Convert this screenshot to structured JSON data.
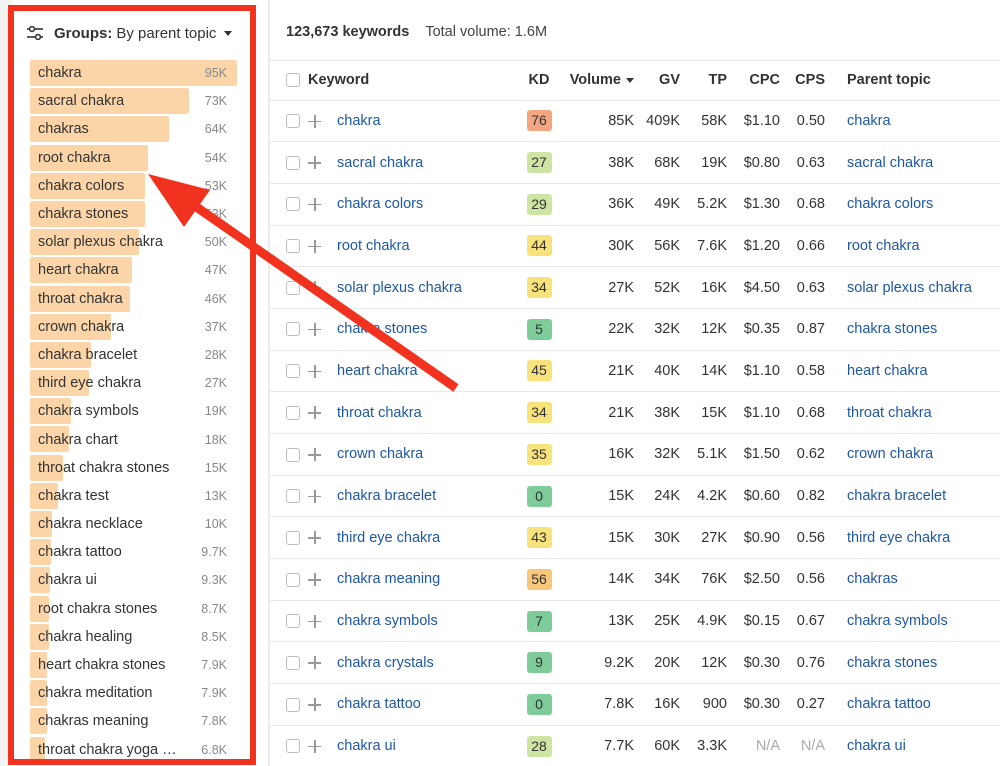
{
  "sidebar": {
    "header": {
      "label": "Groups:",
      "value": "By parent topic"
    },
    "groups": [
      {
        "label": "chakra",
        "count": "95K",
        "volume": 95
      },
      {
        "label": "sacral chakra",
        "count": "73K",
        "volume": 73
      },
      {
        "label": "chakras",
        "count": "64K",
        "volume": 64
      },
      {
        "label": "root chakra",
        "count": "54K",
        "volume": 54
      },
      {
        "label": "chakra colors",
        "count": "53K",
        "volume": 53
      },
      {
        "label": "chakra stones",
        "count": "53K",
        "volume": 53
      },
      {
        "label": "solar plexus chakra",
        "count": "50K",
        "volume": 50
      },
      {
        "label": "heart chakra",
        "count": "47K",
        "volume": 47
      },
      {
        "label": "throat chakra",
        "count": "46K",
        "volume": 46
      },
      {
        "label": "crown chakra",
        "count": "37K",
        "volume": 37
      },
      {
        "label": "chakra bracelet",
        "count": "28K",
        "volume": 28
      },
      {
        "label": "third eye chakra",
        "count": "27K",
        "volume": 27
      },
      {
        "label": "chakra symbols",
        "count": "19K",
        "volume": 19
      },
      {
        "label": "chakra chart",
        "count": "18K",
        "volume": 18
      },
      {
        "label": "throat chakra stones",
        "count": "15K",
        "volume": 15
      },
      {
        "label": "chakra test",
        "count": "13K",
        "volume": 13
      },
      {
        "label": "chakra necklace",
        "count": "10K",
        "volume": 10
      },
      {
        "label": "chakra tattoo",
        "count": "9.7K",
        "volume": 9.7
      },
      {
        "label": "chakra ui",
        "count": "9.3K",
        "volume": 9.3
      },
      {
        "label": "root chakra stones",
        "count": "8.7K",
        "volume": 8.7
      },
      {
        "label": "chakra healing",
        "count": "8.5K",
        "volume": 8.5
      },
      {
        "label": "heart chakra stones",
        "count": "7.9K",
        "volume": 7.9
      },
      {
        "label": "chakra meditation",
        "count": "7.9K",
        "volume": 7.9
      },
      {
        "label": "chakras meaning",
        "count": "7.8K",
        "volume": 7.8
      },
      {
        "label": "throat chakra yoga …",
        "count": "6.8K",
        "volume": 6.8
      }
    ]
  },
  "main": {
    "summary": {
      "keywords": "123,673 keywords",
      "total_volume": "Total volume: 1.6M"
    },
    "columns": {
      "keyword": "Keyword",
      "kd": "KD",
      "volume": "Volume",
      "gv": "GV",
      "tp": "TP",
      "cpc": "CPC",
      "cps": "CPS",
      "parent": "Parent topic"
    },
    "rows": [
      {
        "keyword": "chakra",
        "kd": "76",
        "kd_color": "#f4a582",
        "volume": "85K",
        "gv": "409K",
        "tp": "58K",
        "cpc": "$1.10",
        "cps": "0.50",
        "parent": "chakra"
      },
      {
        "keyword": "sacral chakra",
        "kd": "27",
        "kd_color": "#cde4a3",
        "volume": "38K",
        "gv": "68K",
        "tp": "19K",
        "cpc": "$0.80",
        "cps": "0.63",
        "parent": "sacral chakra"
      },
      {
        "keyword": "chakra colors",
        "kd": "29",
        "kd_color": "#cde4a3",
        "volume": "36K",
        "gv": "49K",
        "tp": "5.2K",
        "cpc": "$1.30",
        "cps": "0.68",
        "parent": "chakra colors"
      },
      {
        "keyword": "root chakra",
        "kd": "44",
        "kd_color": "#f7e27c",
        "volume": "30K",
        "gv": "56K",
        "tp": "7.6K",
        "cpc": "$1.20",
        "cps": "0.66",
        "parent": "root chakra"
      },
      {
        "keyword": "solar plexus chakra",
        "kd": "34",
        "kd_color": "#f7e27c",
        "volume": "27K",
        "gv": "52K",
        "tp": "16K",
        "cpc": "$4.50",
        "cps": "0.63",
        "parent": "solar plexus chakra"
      },
      {
        "keyword": "chakra stones",
        "kd": "5",
        "kd_color": "#7fcc9b",
        "volume": "22K",
        "gv": "32K",
        "tp": "12K",
        "cpc": "$0.35",
        "cps": "0.87",
        "parent": "chakra stones"
      },
      {
        "keyword": "heart chakra",
        "kd": "45",
        "kd_color": "#f7e27c",
        "volume": "21K",
        "gv": "40K",
        "tp": "14K",
        "cpc": "$1.10",
        "cps": "0.58",
        "parent": "heart chakra"
      },
      {
        "keyword": "throat chakra",
        "kd": "34",
        "kd_color": "#f7e27c",
        "volume": "21K",
        "gv": "38K",
        "tp": "15K",
        "cpc": "$1.10",
        "cps": "0.68",
        "parent": "throat chakra"
      },
      {
        "keyword": "crown chakra",
        "kd": "35",
        "kd_color": "#f7e27c",
        "volume": "16K",
        "gv": "32K",
        "tp": "5.1K",
        "cpc": "$1.50",
        "cps": "0.62",
        "parent": "crown chakra"
      },
      {
        "keyword": "chakra bracelet",
        "kd": "0",
        "kd_color": "#7fcc9b",
        "volume": "15K",
        "gv": "24K",
        "tp": "4.2K",
        "cpc": "$0.60",
        "cps": "0.82",
        "parent": "chakra bracelet"
      },
      {
        "keyword": "third eye chakra",
        "kd": "43",
        "kd_color": "#f7e27c",
        "volume": "15K",
        "gv": "30K",
        "tp": "27K",
        "cpc": "$0.90",
        "cps": "0.56",
        "parent": "third eye chakra"
      },
      {
        "keyword": "chakra meaning",
        "kd": "56",
        "kd_color": "#f9c77a",
        "volume": "14K",
        "gv": "34K",
        "tp": "76K",
        "cpc": "$2.50",
        "cps": "0.56",
        "parent": "chakras"
      },
      {
        "keyword": "chakra symbols",
        "kd": "7",
        "kd_color": "#7fcc9b",
        "volume": "13K",
        "gv": "25K",
        "tp": "4.9K",
        "cpc": "$0.15",
        "cps": "0.67",
        "parent": "chakra symbols"
      },
      {
        "keyword": "chakra crystals",
        "kd": "9",
        "kd_color": "#7fcc9b",
        "volume": "9.2K",
        "gv": "20K",
        "tp": "12K",
        "cpc": "$0.30",
        "cps": "0.76",
        "parent": "chakra stones"
      },
      {
        "keyword": "chakra tattoo",
        "kd": "0",
        "kd_color": "#7fcc9b",
        "volume": "7.8K",
        "gv": "16K",
        "tp": "900",
        "cpc": "$0.30",
        "cps": "0.27",
        "parent": "chakra tattoo"
      },
      {
        "keyword": "chakra ui",
        "kd": "28",
        "kd_color": "#cde4a3",
        "volume": "7.7K",
        "gv": "60K",
        "tp": "3.3K",
        "cpc": "N/A",
        "cps": "N/A",
        "parent": "chakra ui"
      }
    ]
  },
  "colors": {
    "group_bar": "#fbd5a8",
    "link": "#1f57a5",
    "highlight": "#f0321e"
  }
}
